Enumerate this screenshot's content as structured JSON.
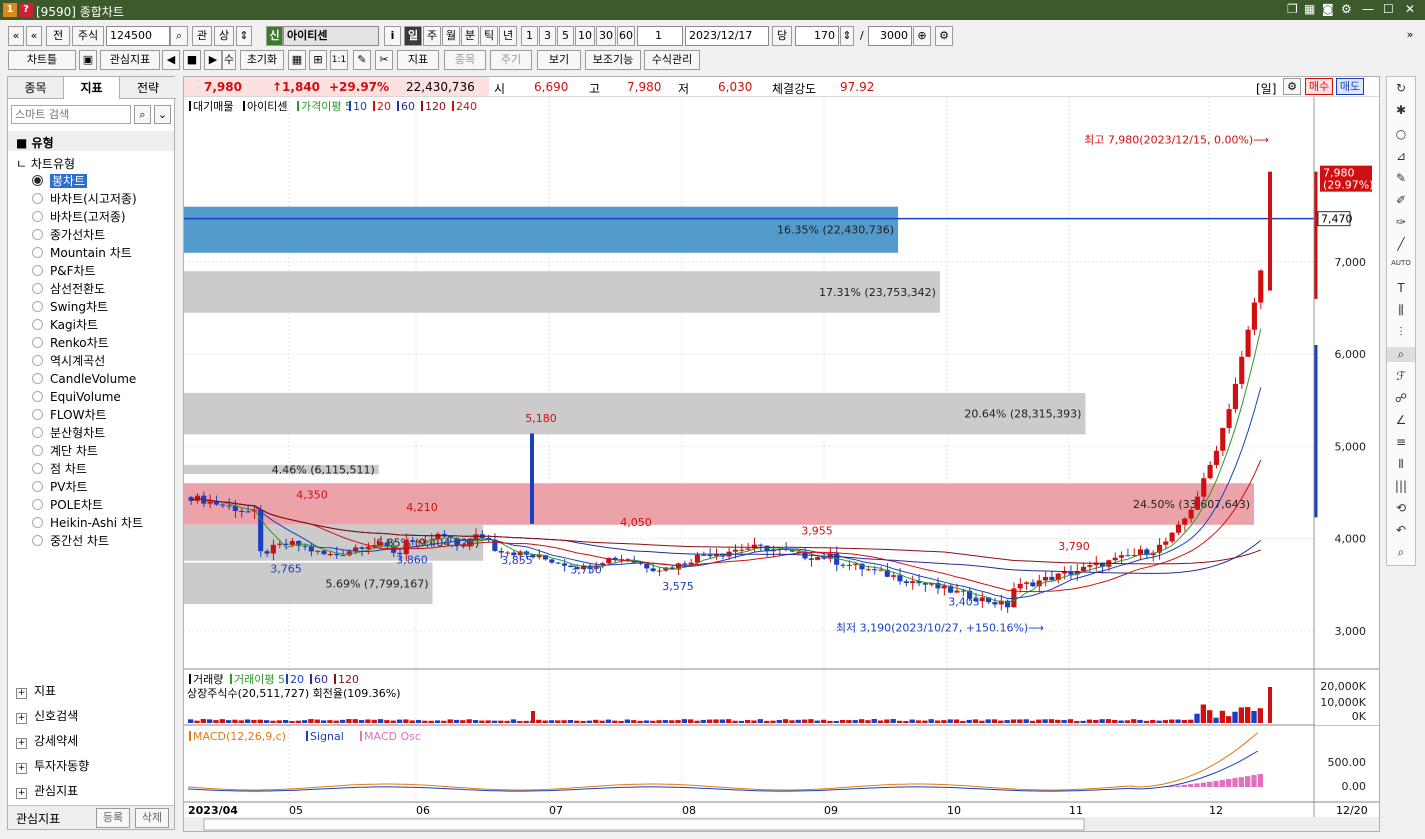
{
  "window": {
    "num1": "1",
    "num2": "?",
    "title": "[9590] 종합차트",
    "ctl_icons": [
      "restore-icon",
      "grid-icon",
      "camera-icon",
      "gear-icon",
      "minimize-icon",
      "maximize-icon",
      "close-icon"
    ]
  },
  "toolbar1": {
    "prev2": "«",
    "prev1": "«",
    "btn_jeon": "전",
    "type_select": "주식",
    "code": "124500",
    "search_icon": "⌕",
    "btn_gwan": "관",
    "btn_sang": "상",
    "badge_new": "신",
    "stock_name": "아이티센",
    "btn_i": "i",
    "periods": [
      "일",
      "주",
      "월",
      "분",
      "틱",
      "년"
    ],
    "active_period": "일",
    "numbers": [
      "1",
      "3",
      "5",
      "10",
      "30",
      "60"
    ],
    "count_select": "1",
    "date": "2023/12/17",
    "btn_dang": "당",
    "bars": "170",
    "slash": "/",
    "max_bars": "3000",
    "right_arrow": "»"
  },
  "toolbar2": {
    "chart_type": "차트틀",
    "btn_save": "💾",
    "btn_indicator": "관심지표",
    "btn_su": "수",
    "btn_reset": "초기화",
    "btn_11": "1:1",
    "btn_jipyo": "지표",
    "btn_jongmok": "종목",
    "btn_jugi": "주기",
    "btn_bogi": "보기",
    "btn_aux": "보조기능",
    "btn_formula": "수식관리"
  },
  "left": {
    "tabs": [
      "종목",
      "지표",
      "전략"
    ],
    "active_tab": "지표",
    "search_placeholder": "스마트 검색",
    "section_type": "유형",
    "group": "차트유형",
    "chart_types": [
      "봉차트",
      "바차트(시고저종)",
      "바차트(고저종)",
      "종가선차트",
      "Mountain 차트",
      "P&F차트",
      "삼선전환도",
      "Swing차트",
      "Kagi차트",
      "Renko차트",
      "역시계곡선",
      "CandleVolume",
      "EquiVolume",
      "FLOW차트",
      "분산형차트",
      "계단 차트",
      "점 차트",
      "PV차트",
      "POLE차트",
      "Heikin-Ashi 차트",
      "중간선 차트"
    ],
    "selected": "봉차트",
    "bottom_sections": [
      "지표",
      "신호검색",
      "강세약세",
      "투자자동향",
      "관심지표"
    ],
    "footer_label": "관심지표",
    "btn_register": "등록",
    "btn_delete": "삭제"
  },
  "price_info": {
    "price": "7,980",
    "change": "↑1,840",
    "pct": "+29.97%",
    "volume": "22,430,736",
    "open_lbl": "시",
    "open": "6,690",
    "high_lbl": "고",
    "high": "7,980",
    "low_lbl": "저",
    "low": "6,030",
    "strength_lbl": "체결강도",
    "strength": "97.92",
    "period_tag": "[일]",
    "buy": "매수",
    "sell": "매도"
  },
  "chart": {
    "legend_main": [
      "대기매물",
      "아이티센",
      "가격이평 5",
      "10",
      "20",
      "60",
      "120",
      "240"
    ],
    "max_label": "최고 7,980(2023/12/15, 0.00%)⟶",
    "min_label": "최저 3,190(2023/10/27, +150.16%)⟶",
    "current_price_tag": "7,980",
    "current_pct_tag": "(29.97%)",
    "line_price_tag": "7,470",
    "y_ticks": [
      "7,000",
      "6,000",
      "5,000",
      "4,000",
      "3,000"
    ],
    "x_ticks": [
      "2023/04",
      "05",
      "06",
      "07",
      "08",
      "09",
      "10",
      "11",
      "12"
    ],
    "date_tag": "12/20",
    "profile": [
      {
        "label": "16.35% (22,430,736)",
        "color": "#4a96c9"
      },
      {
        "label": "17.31% (23,753,342)",
        "color": "#c8c8c8"
      },
      {
        "label": "20.64% (28,315,393)",
        "color": "#c8c8c8"
      },
      {
        "label": "4.46% (6,115,511)",
        "color": "#c8c8c8"
      },
      {
        "label": "24.50% (33,607,643)",
        "color": "#e8939a"
      },
      {
        "label": "6.85% (9,404,923)",
        "color": "#c8c8c8"
      },
      {
        "label": "5.69% (7,799,167)",
        "color": "#c8c8c8"
      }
    ],
    "annotations": [
      {
        "text": "5,180",
        "color": "#d01010"
      },
      {
        "text": "4,350",
        "color": "#d01010"
      },
      {
        "text": "4,210",
        "color": "#d01010"
      },
      {
        "text": "4,050",
        "color": "#d01010"
      },
      {
        "text": "3,955",
        "color": "#d01010"
      },
      {
        "text": "3,790",
        "color": "#d01010"
      },
      {
        "text": "3,765",
        "color": "#1a3fc0"
      },
      {
        "text": "3,860",
        "color": "#1a3fc0"
      },
      {
        "text": "3,855",
        "color": "#1a3fc0"
      },
      {
        "text": "3,750",
        "color": "#1a3fc0"
      },
      {
        "text": "3,575",
        "color": "#1a3fc0"
      },
      {
        "text": "3,405",
        "color": "#1a3fc0"
      }
    ]
  },
  "volume": {
    "legend": [
      "거래량",
      "거래이평 5",
      "20",
      "60",
      "120"
    ],
    "info": "상장주식수(20,511,727) 회전율(109.36%)",
    "ticks": [
      "20,000K",
      "10,000K",
      "0K"
    ]
  },
  "macd": {
    "legend": [
      "MACD(12,26,9,c)",
      "Signal",
      "MACD Osc"
    ],
    "ticks": [
      "500.00",
      "0.00"
    ]
  },
  "chart_data": {
    "type": "candlestick",
    "title": "",
    "x": [
      "2023/04",
      "05",
      "06",
      "07",
      "08",
      "09",
      "10",
      "11",
      "12"
    ],
    "ylim": [
      2700,
      8100
    ],
    "high": {
      "value": 7980,
      "date": "2023/12/15"
    },
    "low": {
      "value": 3190,
      "date": "2023/10/27"
    },
    "current": 7980,
    "change_pct": 29.97,
    "volume_profile": [
      {
        "price_low": 7100,
        "price_high": 7600,
        "pct": 16.35,
        "volume": 22430736
      },
      {
        "price_low": 6450,
        "price_high": 6900,
        "pct": 17.31,
        "volume": 23753342
      },
      {
        "price_low": 5130,
        "price_high": 5580,
        "pct": 20.64,
        "volume": 28315393
      },
      {
        "price_low": 4700,
        "price_high": 4800,
        "pct": 4.46,
        "volume": 6115511
      },
      {
        "price_low": 4150,
        "price_high": 4600,
        "pct": 24.5,
        "volume": 33607643
      },
      {
        "price_low": 3760,
        "price_high": 4150,
        "pct": 6.85,
        "volume": 9404923
      },
      {
        "price_low": 3290,
        "price_high": 3740,
        "pct": 5.69,
        "volume": 7799167
      }
    ],
    "labeled_points": [
      5180,
      4350,
      4210,
      4050,
      3955,
      3790,
      3765,
      3860,
      3855,
      3750,
      3575,
      3405
    ]
  }
}
